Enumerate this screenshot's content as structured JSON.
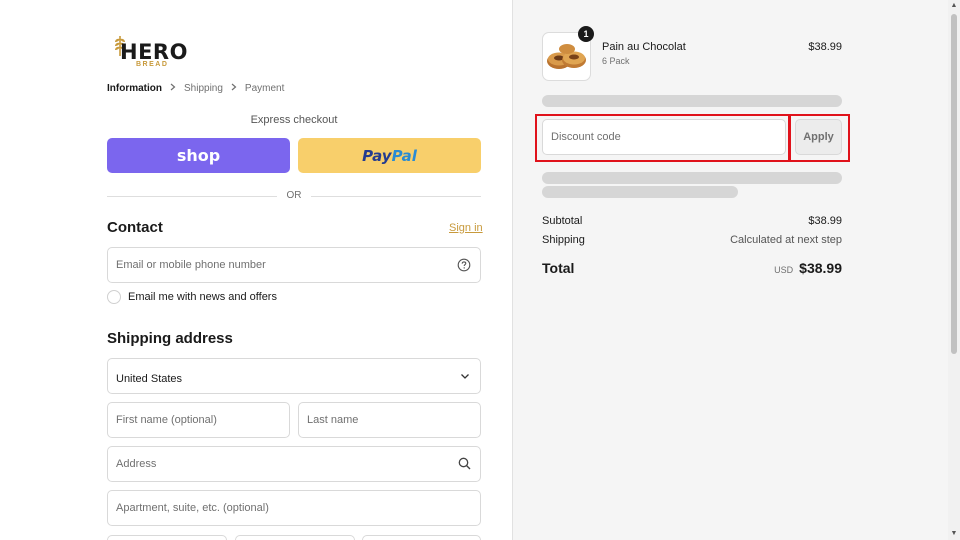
{
  "brand": {
    "name": "HERO",
    "tagline": "BREAD",
    "accent": "#c89a3c"
  },
  "breadcrumb": {
    "items": [
      "Information",
      "Shipping",
      "Payment"
    ],
    "active_index": 0
  },
  "express": {
    "label": "Express checkout",
    "shop_label": "shop",
    "paypal_part1": "Pay",
    "paypal_part2": "Pal",
    "divider": "OR"
  },
  "contact": {
    "title": "Contact",
    "signin_label": "Sign in",
    "email_placeholder": "Email or mobile phone number",
    "newsletter_label": "Email me with news and offers"
  },
  "shipping": {
    "title": "Shipping address",
    "country_value": "United States",
    "first_name_placeholder": "First name (optional)",
    "last_name_placeholder": "Last name",
    "address_placeholder": "Address",
    "apartment_placeholder": "Apartment, suite, etc. (optional)"
  },
  "order": {
    "item": {
      "name": "Pain au Chocolat",
      "variant": "6 Pack",
      "price": "$38.99",
      "quantity": "1"
    },
    "discount": {
      "placeholder": "Discount code",
      "apply_label": "Apply"
    },
    "subtotal_label": "Subtotal",
    "subtotal_value": "$38.99",
    "shipping_label": "Shipping",
    "shipping_value": "Calculated at next step",
    "total_label": "Total",
    "total_currency": "USD",
    "total_value": "$38.99"
  },
  "colors": {
    "shop_button": "#7b66ee",
    "paypal_button": "#f8cf6b",
    "highlight": "#e0121b",
    "summary_bg": "#f5f5f5"
  }
}
